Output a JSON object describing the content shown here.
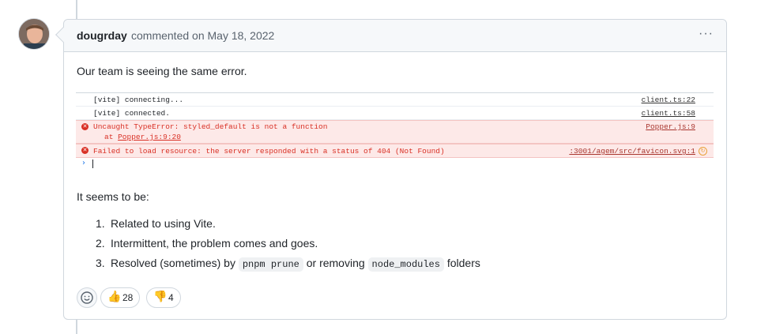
{
  "comment": {
    "author": "dougrday",
    "meta_text": "commented on May 18, 2022",
    "menu_icon": "kebab-horizontal-icon",
    "intro": "Our team is seeing the same error.",
    "after_console": "It seems to be:",
    "list": [
      {
        "num": "1.",
        "text": "Related to using Vite."
      },
      {
        "num": "2.",
        "text": "Intermittent, the problem comes and goes."
      },
      {
        "num": "3.",
        "pre": "Resolved (sometimes) by ",
        "code1": "pnpm prune",
        "mid": " or removing ",
        "code2": "node_modules",
        "post": " folders"
      }
    ]
  },
  "console": {
    "rows": [
      {
        "type": "log",
        "text": "[vite] connecting...",
        "source": "client.ts:22"
      },
      {
        "type": "log",
        "text": "[vite] connected.",
        "source": "client.ts:58"
      },
      {
        "type": "error",
        "text": "Uncaught TypeError: styled_default is not a function",
        "subtext_prefix": "at ",
        "subtext_link": "Popper.js:9:20",
        "source": "Popper.js:9"
      },
      {
        "type": "error",
        "text": "Failed to load resource: the server responded with a status of 404 (Not Found)",
        "source": ":3001/agem/src/favicon.svg:1"
      }
    ],
    "prompt_symbol": "›"
  },
  "reactions": {
    "picker_icon": "smiley-icon",
    "items": [
      {
        "emoji": "👍",
        "name": "thumbs-up",
        "count": "28"
      },
      {
        "emoji": "👎",
        "name": "thumbs-down",
        "count": "4"
      }
    ]
  },
  "colors": {
    "border": "#d0d7de",
    "header_bg": "#f6f8fa",
    "error_red": "#d93025",
    "error_bg": "#fde9e8",
    "muted": "#59636e"
  }
}
